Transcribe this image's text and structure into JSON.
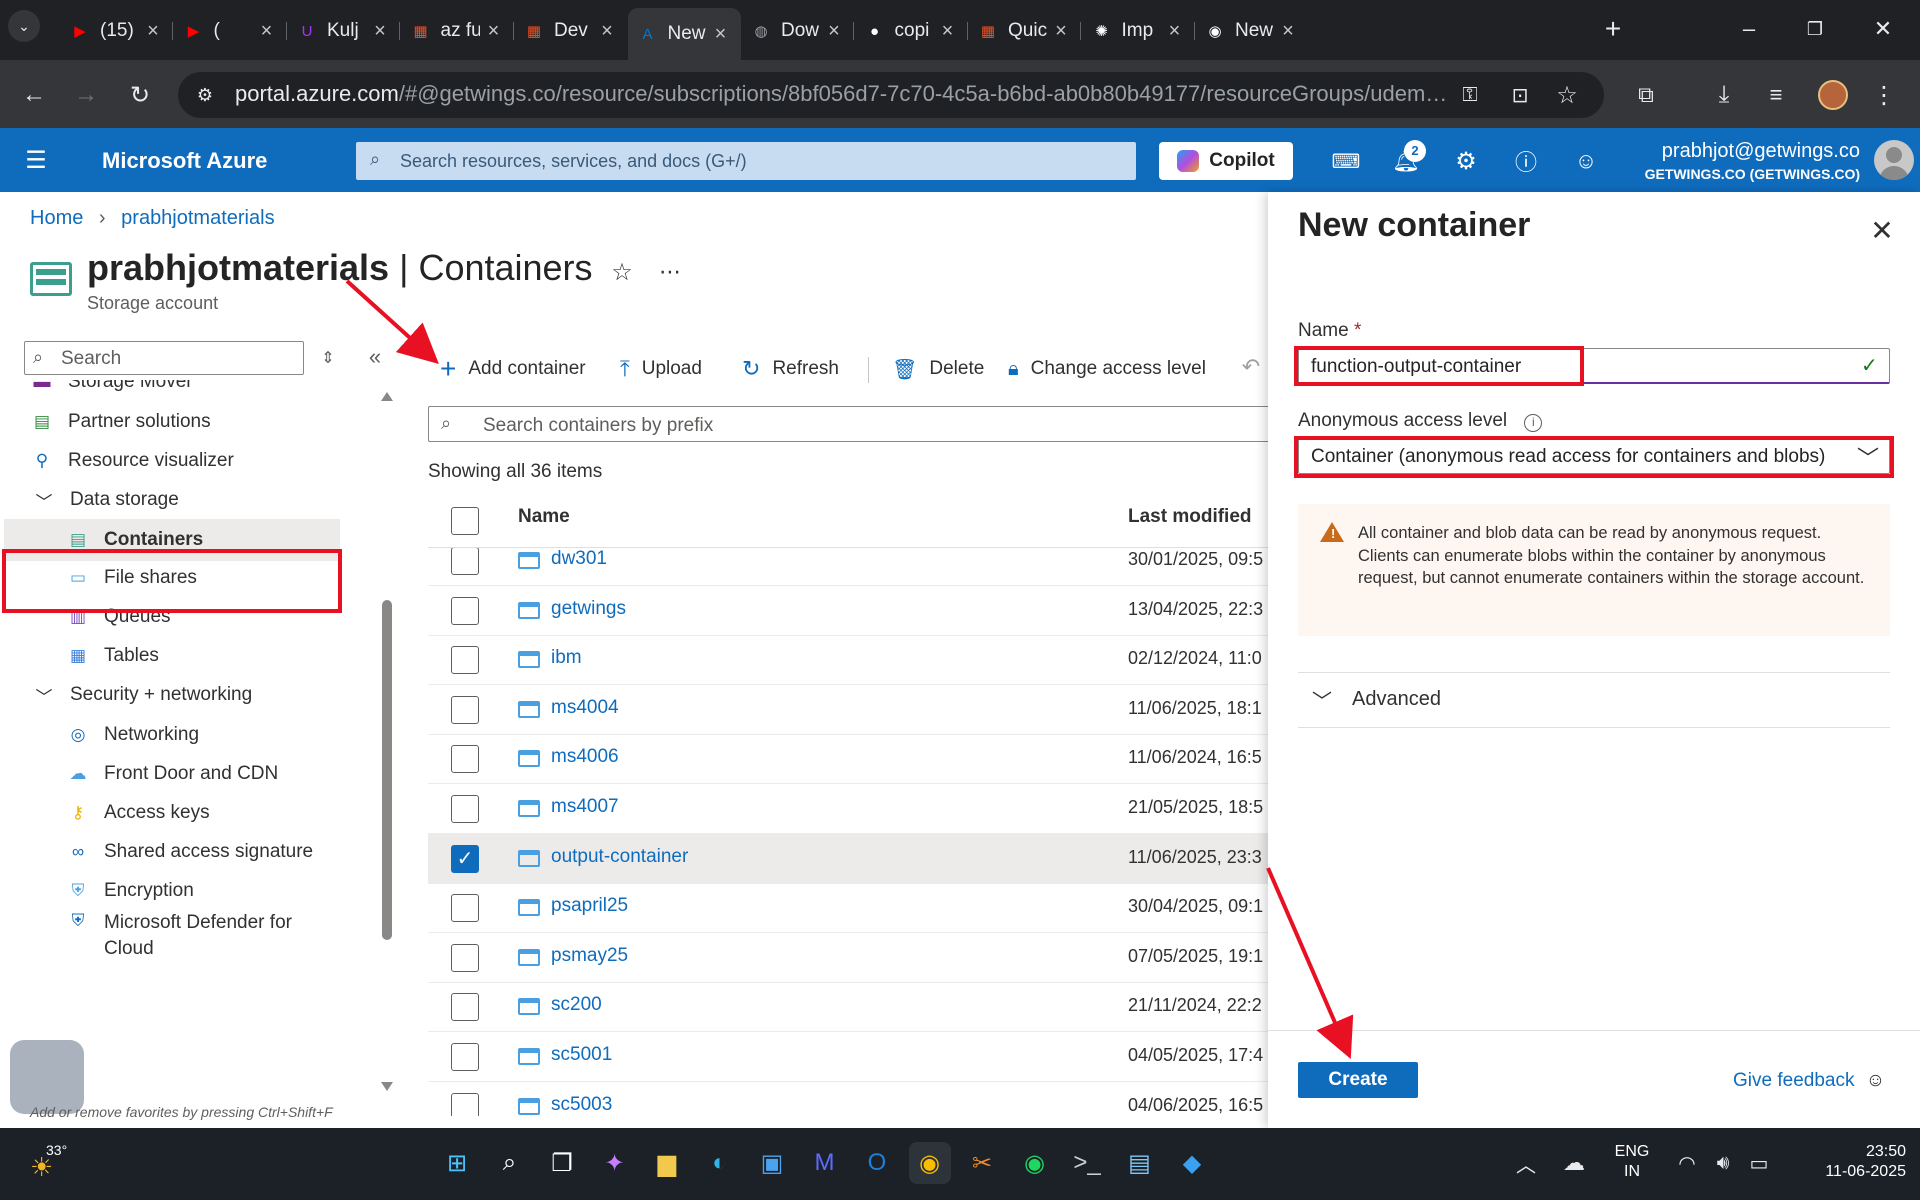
{
  "browser": {
    "tabs": [
      {
        "label": "(15)",
        "icon": "youtube-icon",
        "color": "#ff0000"
      },
      {
        "label": "(",
        "icon": "youtube-icon",
        "color": "#ff0000"
      },
      {
        "label": "Kulj",
        "icon": "udemy-icon",
        "color": "#a435f0"
      },
      {
        "label": "az fu",
        "icon": "microsoft-icon",
        "color": "#f25022"
      },
      {
        "label": "Dev",
        "icon": "microsoft-icon",
        "color": "#f25022"
      },
      {
        "label": "New",
        "icon": "azure-icon",
        "color": "#0078d4"
      },
      {
        "label": "Dow",
        "icon": "globe-icon",
        "color": "#9aa0a6"
      },
      {
        "label": "copi",
        "icon": "github-icon",
        "color": "#ffffff"
      },
      {
        "label": "Quic",
        "icon": "microsoft-icon",
        "color": "#f25022"
      },
      {
        "label": "Imp",
        "icon": "chatgpt-icon",
        "color": "#ffffff"
      },
      {
        "label": "New",
        "icon": "chrome-icon",
        "color": "#ffffff"
      }
    ],
    "url_host": "portal.azure.com",
    "url_rest": "/#@getwings.co/resource/subscriptions/8bf056d7-7c70-4c5a-b6bd-ab0b80b49177/resourceGroups/udemymat..."
  },
  "azure": {
    "brand": "Microsoft Azure",
    "search_placeholder": "Search resources, services, and docs (G+/)",
    "copilot_label": "Copilot",
    "notification_count": "2",
    "user_email": "prabhjot@getwings.co",
    "user_tenant": "GETWINGS.CO (GETWINGS.CO)"
  },
  "breadcrumb": {
    "home": "Home",
    "resource": "prabhjotmaterials"
  },
  "page": {
    "title_resource": "prabhjotmaterials",
    "title_sep": " | ",
    "title_blade": "Containers",
    "subtitle": "Storage account"
  },
  "nav": {
    "search_placeholder": "Search",
    "items": [
      {
        "label": "Storage Mover",
        "icon": "storage-mover-icon",
        "group": false
      },
      {
        "label": "Partner solutions",
        "icon": "partner-icon",
        "group": false
      },
      {
        "label": "Resource visualizer",
        "icon": "visualizer-icon",
        "group": false
      },
      {
        "label": "Data storage",
        "icon": "chevron-down-icon",
        "group": true
      },
      {
        "label": "Containers",
        "icon": "containers-icon",
        "group": false,
        "sub": true,
        "selected": true
      },
      {
        "label": "File shares",
        "icon": "file-shares-icon",
        "group": false,
        "sub": true
      },
      {
        "label": "Queues",
        "icon": "queues-icon",
        "group": false,
        "sub": true
      },
      {
        "label": "Tables",
        "icon": "tables-icon",
        "group": false,
        "sub": true
      },
      {
        "label": "Security + networking",
        "icon": "chevron-down-icon",
        "group": true
      },
      {
        "label": "Networking",
        "icon": "networking-icon",
        "group": false,
        "sub": true
      },
      {
        "label": "Front Door and CDN",
        "icon": "cdn-icon",
        "group": false,
        "sub": true
      },
      {
        "label": "Access keys",
        "icon": "key-icon",
        "group": false,
        "sub": true
      },
      {
        "label": "Shared access signature",
        "icon": "link-icon",
        "group": false,
        "sub": true
      },
      {
        "label": "Encryption",
        "icon": "lock-icon",
        "group": false,
        "sub": true
      },
      {
        "label": "Microsoft Defender for",
        "label2": "Cloud",
        "icon": "defender-icon",
        "group": false,
        "sub": true
      }
    ],
    "favorites_hint": "Add or remove favorites by pressing Ctrl+Shift+F"
  },
  "toolbar": {
    "add_container": "Add container",
    "upload": "Upload",
    "refresh": "Refresh",
    "delete": "Delete",
    "change_access": "Change access level"
  },
  "list": {
    "search_placeholder": "Search containers by prefix",
    "count_text": "Showing all 36 items",
    "col_name": "Name",
    "col_modified": "Last modified",
    "rows": [
      {
        "name": "dw301",
        "modified": "30/01/2025, 09:5",
        "checked": false
      },
      {
        "name": "getwings",
        "modified": "13/04/2025, 22:3",
        "checked": false
      },
      {
        "name": "ibm",
        "modified": "02/12/2024, 11:0",
        "checked": false
      },
      {
        "name": "ms4004",
        "modified": "11/06/2025, 18:1",
        "checked": false
      },
      {
        "name": "ms4006",
        "modified": "11/06/2024, 16:5",
        "checked": false
      },
      {
        "name": "ms4007",
        "modified": "21/05/2025, 18:5",
        "checked": false
      },
      {
        "name": "output-container",
        "modified": "11/06/2025, 23:3",
        "checked": true
      },
      {
        "name": "psapril25",
        "modified": "30/04/2025, 09:1",
        "checked": false
      },
      {
        "name": "psmay25",
        "modified": "07/05/2025, 19:1",
        "checked": false
      },
      {
        "name": "sc200",
        "modified": "21/11/2024, 22:2",
        "checked": false
      },
      {
        "name": "sc5001",
        "modified": "04/05/2025, 17:4",
        "checked": false
      },
      {
        "name": "sc5003",
        "modified": "04/06/2025, 16:5",
        "checked": false
      }
    ]
  },
  "panel": {
    "title": "New container",
    "name_label": "Name",
    "required_mark": "*",
    "name_value": "function-output-container",
    "access_label": "Anonymous access level",
    "access_value": "Container (anonymous read access for containers and blobs)",
    "warning_text": "All container and blob data can be read by anonymous request. Clients can enumerate blobs within the container by anonymous request, but cannot enumerate containers within the storage account.",
    "advanced_label": "Advanced",
    "create_label": "Create",
    "feedback_label": "Give feedback"
  },
  "taskbar": {
    "weather": "33°",
    "lang_line1": "ENG",
    "lang_line2": "IN",
    "time": "23:50",
    "date": "11-06-2025",
    "apps": [
      "start-icon",
      "search-icon",
      "task-view-icon",
      "copilot-app-icon",
      "file-explorer-icon",
      "edge-icon",
      "store-icon",
      "ai-app-icon",
      "outlook-icon",
      "chrome-icon",
      "snipping-icon",
      "spotify-icon",
      "terminal-icon",
      "notepad-icon",
      "vscode-icon"
    ]
  },
  "colors": {
    "azure_blue": "#0f6cbd",
    "annotation_red": "#e81123"
  }
}
